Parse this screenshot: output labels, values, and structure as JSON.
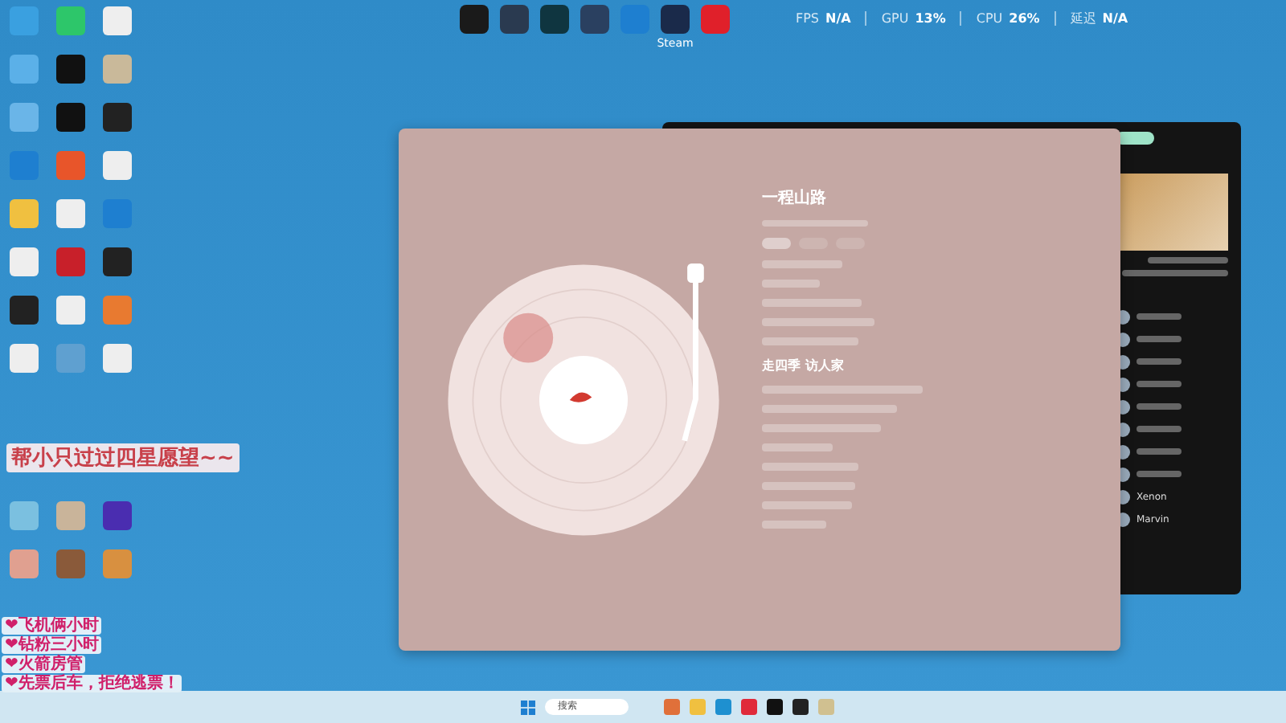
{
  "top_shortcuts": [
    {
      "label": "Steam"
    }
  ],
  "stats": [
    {
      "label": "FPS",
      "value": "N/A"
    },
    {
      "label": "GPU",
      "value": "13%"
    },
    {
      "label": "CPU",
      "value": "26%"
    },
    {
      "label": "延迟",
      "value": "N/A"
    }
  ],
  "player": {
    "title": "一程山路",
    "lyrics": [
      {
        "text": "走四季 访人家",
        "current": true
      }
    ]
  },
  "chat": {
    "members": [
      {
        "name": "Xenon"
      },
      {
        "name": "Marvin"
      }
    ]
  },
  "overlay": {
    "banner": "帮小只过过四星愿望~~",
    "notes": [
      "❤飞机俩小时",
      "❤钻粉三小时",
      "❤火箭房管",
      "❤先票后车，拒绝逃票！"
    ]
  },
  "taskbar": {
    "search_placeholder": "搜索"
  }
}
